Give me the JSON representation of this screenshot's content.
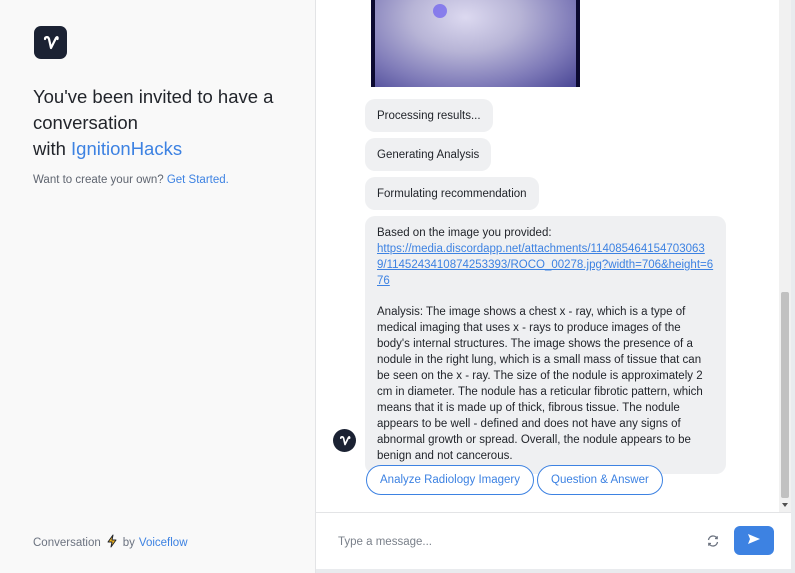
{
  "sidebar": {
    "logo_letter": "V",
    "invite_line": "You've been invited to have a conversation",
    "with_prefix": "with",
    "company": "IgnitionHacks",
    "cta_text": "Want to create your own?",
    "cta_link": "Get Started.",
    "footer_prefix": "Conversation",
    "footer_by": "by",
    "footer_brand": "Voiceflow"
  },
  "chat": {
    "messages": [
      "Processing results...",
      "Generating Analysis",
      "Formulating recommendation"
    ],
    "analysis": {
      "intro": "Based on the image you provided:",
      "link": "https://media.discordapp.net/attachments/1140854641547030639/1145243410874253393/ROCO_00278.jpg?width=706&height=676",
      "body": "Analysis: The image shows a chest x - ray, which is a type of medical imaging that uses x - rays to produce images of the body's internal structures. The image shows the presence of a nodule in the right lung, which is a small mass of tissue that can be seen on the x - ray. The size of the nodule is approximately 2 cm in diameter. The nodule has a reticular fibrotic pattern, which means that it is made up of thick, fibrous tissue. The nodule appears to be well - defined and does not have any signs of abnormal growth or spread. Overall, the nodule appears to be benign and not cancerous."
    },
    "buttons": [
      "Analyze Radiology Imagery",
      "Question & Answer"
    ]
  },
  "composer": {
    "placeholder": "Type a message...",
    "value": ""
  },
  "colors": {
    "accent": "#3d82e2",
    "brand_dark": "#1b2233",
    "bubble": "#eff0f2"
  },
  "icons": {
    "logo": "voiceflow-logo-icon",
    "lightning": "lightning-icon",
    "refresh": "refresh-icon",
    "send": "send-icon"
  }
}
